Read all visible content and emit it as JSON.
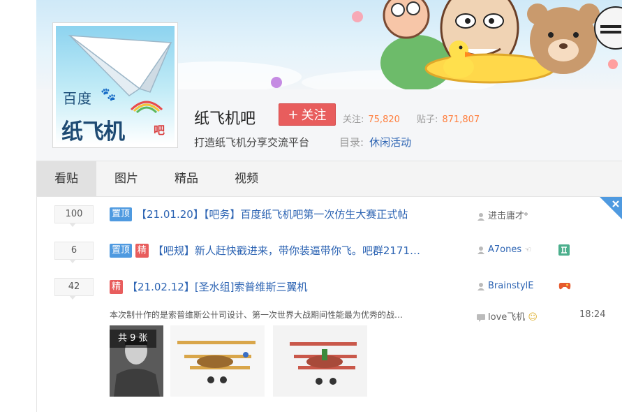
{
  "forum": {
    "name": "纸飞机吧",
    "follow_label": "关注",
    "followers_label": "关注:",
    "followers": "75,820",
    "posts_label": "贴子:",
    "posts": "871,807",
    "slogan": "打造纸飞机分享交流平台",
    "catalog_label": "目录:",
    "catalog_value": "休闲活动",
    "avatar_text_top": "百度",
    "avatar_text_main": "纸飞机",
    "avatar_text_ba": "吧"
  },
  "tabs": [
    {
      "label": "看贴"
    },
    {
      "label": "图片"
    },
    {
      "label": "精品"
    },
    {
      "label": "视频"
    }
  ],
  "threads": [
    {
      "replies": "100",
      "badges": [
        "置顶"
      ],
      "title": "【21.01.20】【吧务】百度纸飞机吧第一次仿生大赛正式帖",
      "author": "进击庸才ᵒ"
    },
    {
      "replies": "6",
      "badges": [
        "置顶",
        "精"
      ],
      "title": "【吧规】新人赶快戳进来，带你装逼带你飞。吧群2171…",
      "author": "A7ones"
    },
    {
      "replies": "42",
      "badges": [
        "精"
      ],
      "title": "【21.02.12】[圣水组]索普维斯三翼机",
      "author": "BrainstylE",
      "abstract": "本次制卄作的是索普维斯公卄司设计、第一次世界大战期间性能最为优秀的战…",
      "last_reply_user": "love飞机",
      "last_reply_time": "18:24",
      "image_count": "共 9 张"
    }
  ],
  "colors": {
    "link": "#2d64b3",
    "follow_button": "#e85d5d",
    "stat_number": "#ff7f3e",
    "badge_top": "#4f9ae0",
    "badge_good": "#e85d5d"
  }
}
